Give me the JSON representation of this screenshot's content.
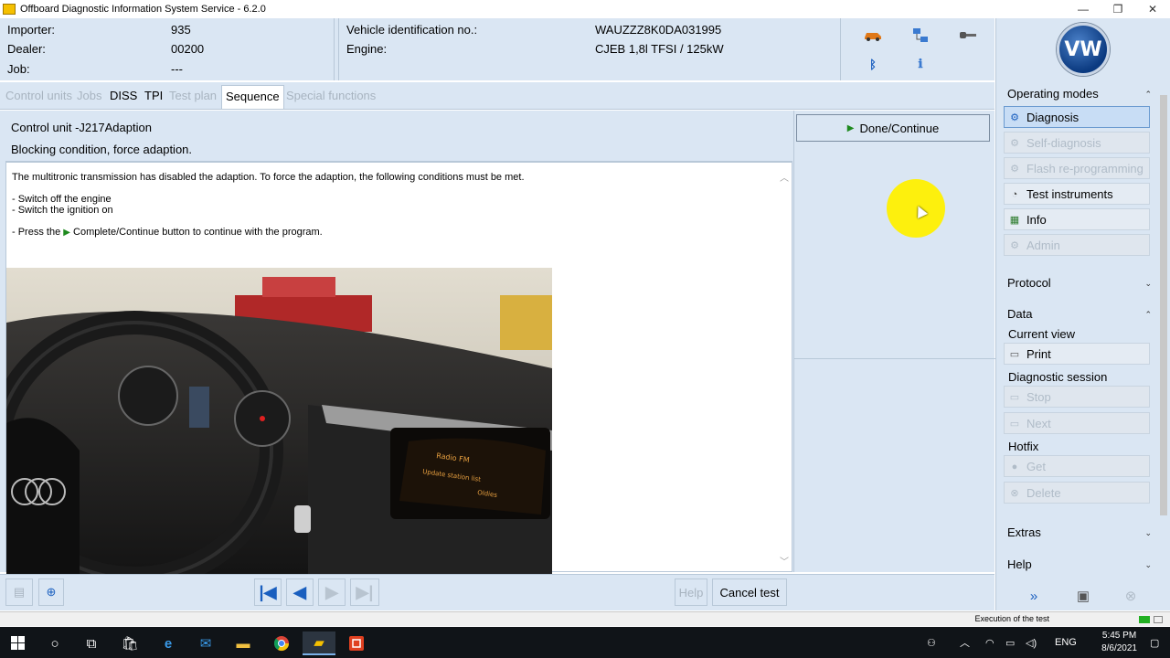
{
  "window": {
    "title": "Offboard Diagnostic Information System Service - 6.2.0",
    "minimize": "—",
    "maximize": "❐",
    "close": "✕"
  },
  "header": {
    "importer_label": "Importer:",
    "importer_value": "935",
    "dealer_label": "Dealer:",
    "dealer_value": "00200",
    "job_label": "Job:",
    "job_value": "---",
    "vin_label": "Vehicle identification no.:",
    "vin_value": "WAUZZZ8K0DA031995",
    "engine_label": "Engine:",
    "engine_value": "CJEB 1,8l TFSI / 125kW",
    "icons": [
      "car-icon",
      "network-icon",
      "key-icon",
      "bluetooth-icon",
      "info-plug-icon"
    ]
  },
  "tabs": [
    {
      "label": "Control units",
      "state": "disabled"
    },
    {
      "label": "Jobs",
      "state": "disabled"
    },
    {
      "label": "DISS",
      "state": "enabled"
    },
    {
      "label": "TPI",
      "state": "enabled"
    },
    {
      "label": "Test plan",
      "state": "disabled"
    },
    {
      "label": "Sequence",
      "state": "active"
    },
    {
      "label": "Special functions",
      "state": "disabled"
    }
  ],
  "content": {
    "unit_title": "Control unit -J217Adaption",
    "condition": "Blocking condition, force adaption.",
    "text1": "The multitronic transmission has disabled the adaption. To force the adaption, the following conditions must be met.",
    "text2": "- Switch off the engine",
    "text3": "- Switch the ignition on",
    "text4_pre": "- Press the",
    "text4_post": "Complete/Continue button to continue with the program."
  },
  "action": {
    "done_label": "Done/Continue"
  },
  "bottombar": {
    "help_label": "Help",
    "cancel_label": "Cancel test"
  },
  "sidebar": {
    "operating_modes": "Operating modes",
    "modes": [
      {
        "label": "Diagnosis",
        "icon": "diagnosis-icon",
        "state": "selected"
      },
      {
        "label": "Self-diagnosis",
        "icon": "self-diagnosis-icon",
        "state": "disabled"
      },
      {
        "label": "Flash re-programming",
        "icon": "flash-icon",
        "state": "disabled"
      },
      {
        "label": "Test instruments",
        "icon": "gauge-icon",
        "state": "enabled"
      },
      {
        "label": "Info",
        "icon": "books-icon",
        "state": "enabled"
      },
      {
        "label": "Admin",
        "icon": "admin-icon",
        "state": "disabled"
      }
    ],
    "protocol": "Protocol",
    "data": "Data",
    "current_view": "Current view",
    "print": "Print",
    "diagnostic_session": "Diagnostic session",
    "stop": "Stop",
    "next": "Next",
    "hotfix": "Hotfix",
    "get": "Get",
    "delete": "Delete",
    "extras": "Extras",
    "help": "Help"
  },
  "statusbar": {
    "text": "Execution of the test"
  },
  "taskbar": {
    "lang": "ENG",
    "time": "5:45 PM",
    "date": "8/6/2021"
  },
  "colors": {
    "panel_bg": "#dae6f3",
    "accent_blue": "#1a5fbf",
    "play_green": "#1e8a1e",
    "cursor_highlight": "#fff000"
  }
}
